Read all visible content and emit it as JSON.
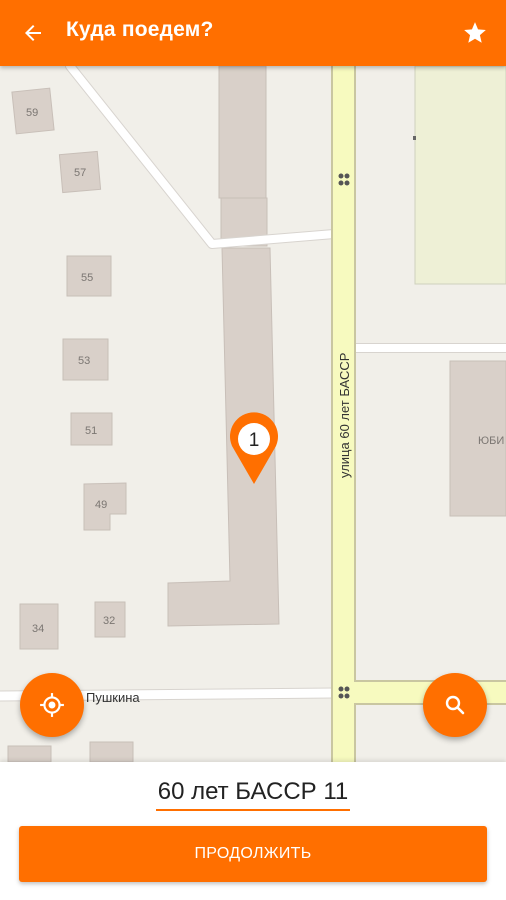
{
  "header": {
    "title": "Куда поедем?",
    "back_icon": "arrow-back-icon",
    "favorite_icon": "star-icon"
  },
  "map": {
    "buildings": [
      "59",
      "57",
      "55",
      "53",
      "51",
      "49",
      "34",
      "32"
    ],
    "poi_label": "ЮБИ",
    "street_vertical": "улица 60 лет БАССР",
    "street_horizontal": "Пушкина",
    "marker_number": "1"
  },
  "fabs": {
    "location_icon": "my-location-icon",
    "search_icon": "search-icon"
  },
  "bottom": {
    "address": "60 лет БАССР 11",
    "continue_label": "ПРОДОЛЖИТЬ"
  },
  "colors": {
    "accent": "#ff6f00",
    "map_background": "#f1efe9",
    "building": "#d9d0c9",
    "road_major": "#f7fabf"
  }
}
